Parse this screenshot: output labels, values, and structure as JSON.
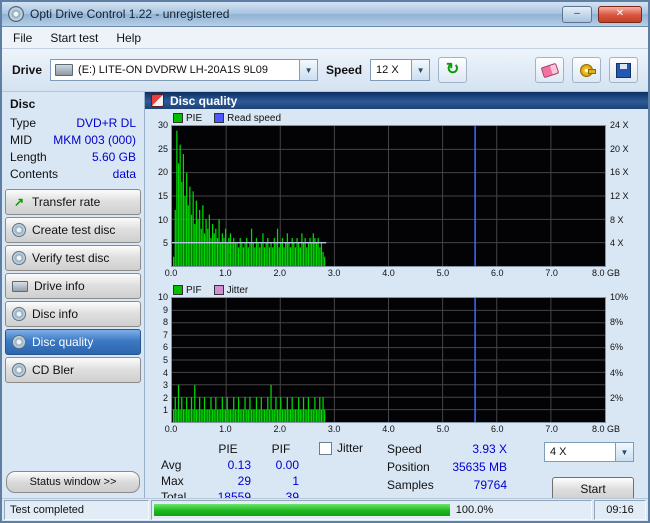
{
  "window": {
    "title": "Opti Drive Control 1.22 - unregistered",
    "minimize": "–",
    "close": "✕"
  },
  "menu": {
    "items": [
      "File",
      "Start test",
      "Help"
    ]
  },
  "toolbar": {
    "drive_label": "Drive",
    "drive_value": "(E:) LITE-ON DVDRW LH-20A1S 9L09",
    "speed_label": "Speed",
    "speed_value": "12 X"
  },
  "sidebar": {
    "header": "Disc",
    "info": [
      {
        "label": "Type",
        "value": "DVD+R DL"
      },
      {
        "label": "MID",
        "value": "MKM 003 (000)"
      },
      {
        "label": "Length",
        "value": "5.60 GB"
      },
      {
        "label": "Contents",
        "value": "data"
      }
    ],
    "buttons": [
      {
        "label": "Transfer rate"
      },
      {
        "label": "Create test disc"
      },
      {
        "label": "Verify test disc"
      },
      {
        "label": "Drive info"
      },
      {
        "label": "Disc info"
      },
      {
        "label": "Disc quality"
      },
      {
        "label": "CD Bler"
      }
    ],
    "status_window": "Status window >>"
  },
  "main": {
    "header": "Disc quality"
  },
  "stats": {
    "col_pie": "PIE",
    "col_pif": "PIF",
    "jitter_label": "Jitter",
    "jitter_checked": false,
    "rows": [
      {
        "label": "Avg",
        "pie": "0.13",
        "pif": "0.00"
      },
      {
        "label": "Max",
        "pie": "29",
        "pif": "1"
      },
      {
        "label": "Total",
        "pie": "18559",
        "pif": "39"
      }
    ],
    "speed_label": "Speed",
    "speed_value": "3.93 X",
    "position_label": "Position",
    "position_value": "35635 MB",
    "samples_label": "Samples",
    "samples_value": "79764",
    "write_speed_value": "4 X",
    "start_label": "Start"
  },
  "statusbar": {
    "status": "Test completed",
    "progress": "100.0%",
    "time": "09:16"
  },
  "chart_data": [
    {
      "type": "bar",
      "title": "PIE / Read speed",
      "legend": [
        {
          "label": "PIE",
          "color": "#00c000"
        },
        {
          "label": "Read speed",
          "color": "#4a5aff"
        }
      ],
      "x_range": [
        0,
        8
      ],
      "x_unit": "GB",
      "x_ticks": [
        {
          "label": "0.0",
          "at": 0
        },
        {
          "label": "1.0",
          "at": 1
        },
        {
          "label": "2.0",
          "at": 2
        },
        {
          "label": "3.0",
          "at": 3
        },
        {
          "label": "4.0",
          "at": 4
        },
        {
          "label": "5.0",
          "at": 5
        },
        {
          "label": "6.0",
          "at": 6
        },
        {
          "label": "7.0",
          "at": 7
        },
        {
          "label": "8.0 GB",
          "at": 8
        }
      ],
      "y_left": {
        "max": 30,
        "ticks": [
          {
            "label": "30",
            "at": 30
          },
          {
            "label": "25",
            "at": 25
          },
          {
            "label": "20",
            "at": 20
          },
          {
            "label": "15",
            "at": 15
          },
          {
            "label": "10",
            "at": 10
          },
          {
            "label": "5",
            "at": 5
          }
        ]
      },
      "y_right": [
        {
          "label": "24 X",
          "at": 30
        },
        {
          "label": "20 X",
          "at": 25
        },
        {
          "label": "16 X",
          "at": 20
        },
        {
          "label": "12 X",
          "at": 15
        },
        {
          "label": "8 X",
          "at": 10
        },
        {
          "label": "4 X",
          "at": 5
        }
      ],
      "bar_color": "#00d800",
      "bar_step": 0.03,
      "cursor_x": 5.6,
      "read_speed_line": {
        "y": 5,
        "x_start": 0,
        "x_end": 2.85,
        "color": "#b8c4e8"
      },
      "values": [
        0,
        2,
        12,
        29,
        22,
        26,
        18,
        24,
        15,
        20,
        13,
        17,
        11,
        16,
        9,
        14,
        10,
        12,
        8,
        13,
        7,
        10,
        8,
        11,
        6,
        9,
        7,
        8,
        6,
        10,
        5,
        7,
        6,
        8,
        5,
        6,
        7,
        5,
        6,
        5,
        5,
        4,
        6,
        5,
        4,
        5,
        6,
        4,
        5,
        8,
        5,
        4,
        6,
        5,
        4,
        5,
        7,
        4,
        5,
        6,
        4,
        5,
        4,
        6,
        5,
        8,
        4,
        5,
        6,
        4,
        5,
        7,
        5,
        4,
        6,
        5,
        4,
        6,
        5,
        4,
        7,
        5,
        6,
        4,
        5,
        6,
        5,
        7,
        6,
        5,
        6,
        4,
        5,
        3,
        2
      ]
    },
    {
      "type": "bar",
      "title": "PIF / Jitter",
      "legend": [
        {
          "label": "PIF",
          "color": "#00c000"
        },
        {
          "label": "Jitter",
          "color": "#d090d0"
        }
      ],
      "x_range": [
        0,
        8
      ],
      "x_unit": "GB",
      "x_ticks": [
        {
          "label": "0.0",
          "at": 0
        },
        {
          "label": "1.0",
          "at": 1
        },
        {
          "label": "2.0",
          "at": 2
        },
        {
          "label": "3.0",
          "at": 3
        },
        {
          "label": "4.0",
          "at": 4
        },
        {
          "label": "5.0",
          "at": 5
        },
        {
          "label": "6.0",
          "at": 6
        },
        {
          "label": "7.0",
          "at": 7
        },
        {
          "label": "8.0 GB",
          "at": 8
        }
      ],
      "y_left": {
        "max": 10,
        "ticks": [
          {
            "label": "10",
            "at": 10
          },
          {
            "label": "9",
            "at": 9
          },
          {
            "label": "8",
            "at": 8
          },
          {
            "label": "7",
            "at": 7
          },
          {
            "label": "6",
            "at": 6
          },
          {
            "label": "5",
            "at": 5
          },
          {
            "label": "4",
            "at": 4
          },
          {
            "label": "3",
            "at": 3
          },
          {
            "label": "2",
            "at": 2
          },
          {
            "label": "1",
            "at": 1
          }
        ]
      },
      "y_right": [
        {
          "label": "10%",
          "at": 10
        },
        {
          "label": "8%",
          "at": 8
        },
        {
          "label": "6%",
          "at": 6
        },
        {
          "label": "4%",
          "at": 4
        },
        {
          "label": "2%",
          "at": 2
        }
      ],
      "bar_color": "#00d800",
      "bar_step": 0.03,
      "cursor_x": 5.6,
      "values": [
        0,
        1,
        2,
        1,
        3,
        1,
        2,
        1,
        1,
        2,
        1,
        1,
        2,
        1,
        3,
        1,
        1,
        2,
        1,
        1,
        2,
        1,
        1,
        1,
        2,
        1,
        1,
        2,
        1,
        1,
        1,
        2,
        1,
        1,
        2,
        1,
        1,
        1,
        2,
        1,
        1,
        2,
        1,
        1,
        1,
        2,
        1,
        1,
        2,
        1,
        1,
        1,
        2,
        1,
        1,
        2,
        1,
        1,
        1,
        2,
        1,
        3,
        1,
        1,
        2,
        1,
        1,
        2,
        1,
        1,
        1,
        2,
        1,
        1,
        2,
        1,
        1,
        1,
        2,
        1,
        1,
        2,
        1,
        1,
        2,
        1,
        1,
        1,
        2,
        1,
        1,
        2,
        1,
        2,
        1
      ]
    }
  ]
}
